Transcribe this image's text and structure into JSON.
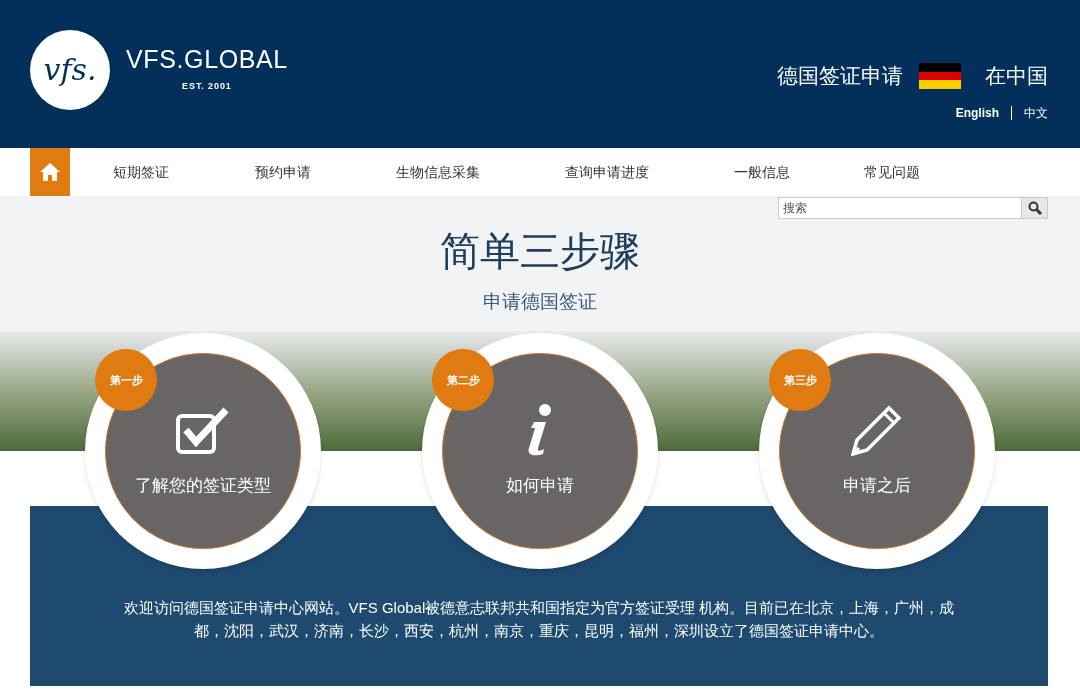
{
  "header": {
    "logo_mark": "vfs.",
    "logo_name": "VFS.GLOBAL",
    "logo_est": "EST. 2001",
    "title": "德国签证申请",
    "title_suffix": "在中国",
    "languages": [
      "English",
      "中文"
    ]
  },
  "nav": {
    "items": [
      "短期签证",
      "预约申请",
      "生物信息采集",
      "查询申请进度",
      "一般信息",
      "常见问题"
    ]
  },
  "search": {
    "placeholder": "搜索"
  },
  "hero": {
    "title": "简单三步骤",
    "subtitle": "申请德国签证"
  },
  "steps": [
    {
      "kind": "check",
      "badge": "第一步",
      "label": "了解您的签证类型"
    },
    {
      "kind": "info",
      "badge": "第二步",
      "label": "如何申请"
    },
    {
      "kind": "pencil",
      "badge": "第三步",
      "label": "申请之后"
    }
  ],
  "intro": "欢迎访问德国签证申请中心网站。VFS Global被德意志联邦共和国指定为官方签证受理 机构。目前已在北京，上海，广州，成都，沈阳，武汉，济南，长沙，西安，杭州，南京，重庆，昆明，福州，深圳设立了德国签证申请中心。"
}
